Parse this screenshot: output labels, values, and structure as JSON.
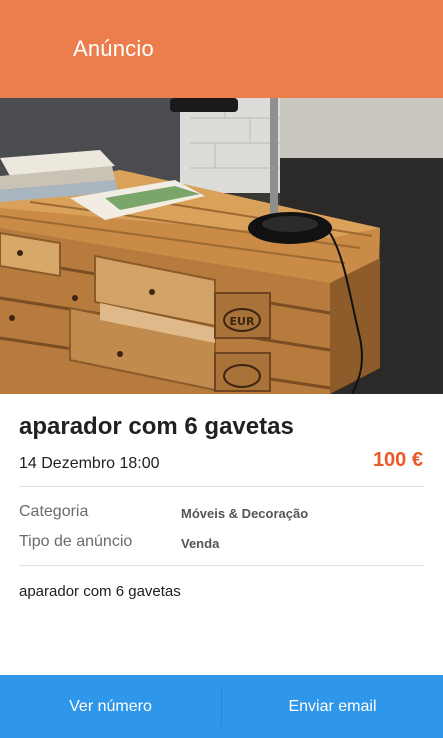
{
  "app_bar": {
    "title": "Anúncio"
  },
  "photo": {
    "stamp_text": "EUR"
  },
  "listing": {
    "title": "aparador com 6 gavetas",
    "date": "14 Dezembro 18:00",
    "price": "100 €",
    "attributes": [
      {
        "label": "Categoria",
        "value": "Móveis & Decoração"
      },
      {
        "label": "Tipo de anúncio",
        "value": "Venda"
      }
    ],
    "description": "aparador com 6 gavetas"
  },
  "actions": {
    "call_label": "Ver número",
    "email_label": "Enviar email"
  },
  "colors": {
    "app_bar": "#ec7e4d",
    "price": "#e95a28",
    "action_bar": "#2f97ea"
  }
}
